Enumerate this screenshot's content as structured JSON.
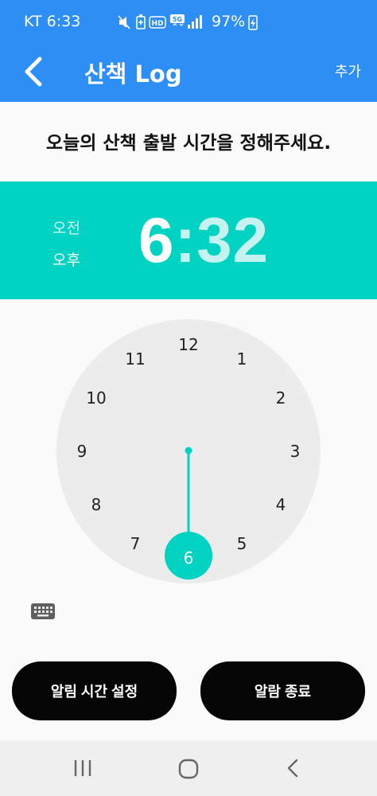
{
  "status_bar": {
    "carrier_time": "KT 6:33",
    "battery": "97%",
    "icons": [
      "mute-icon",
      "battery-saver-icon",
      "hd-icon",
      "5g-icon",
      "signal-icon",
      "charging-icon"
    ]
  },
  "app_bar": {
    "title": "산책 Log",
    "action": "추가"
  },
  "prompt": "오늘의 산책 출발 시간을 정해주세요.",
  "time_picker": {
    "am_label": "오전",
    "pm_label": "오후",
    "hour": "6",
    "separator": ":",
    "minute": "32",
    "selected_hour": "6",
    "hours": [
      "12",
      "1",
      "2",
      "3",
      "4",
      "5",
      "6",
      "7",
      "8",
      "9",
      "10",
      "11"
    ]
  },
  "buttons": {
    "set_alarm": "알림 시간 설정",
    "end_alarm": "알람 종료"
  },
  "colors": {
    "app_bar": "#2d8ef5",
    "accent": "#00d3c2",
    "dial": "#ececec",
    "button": "#050505"
  }
}
